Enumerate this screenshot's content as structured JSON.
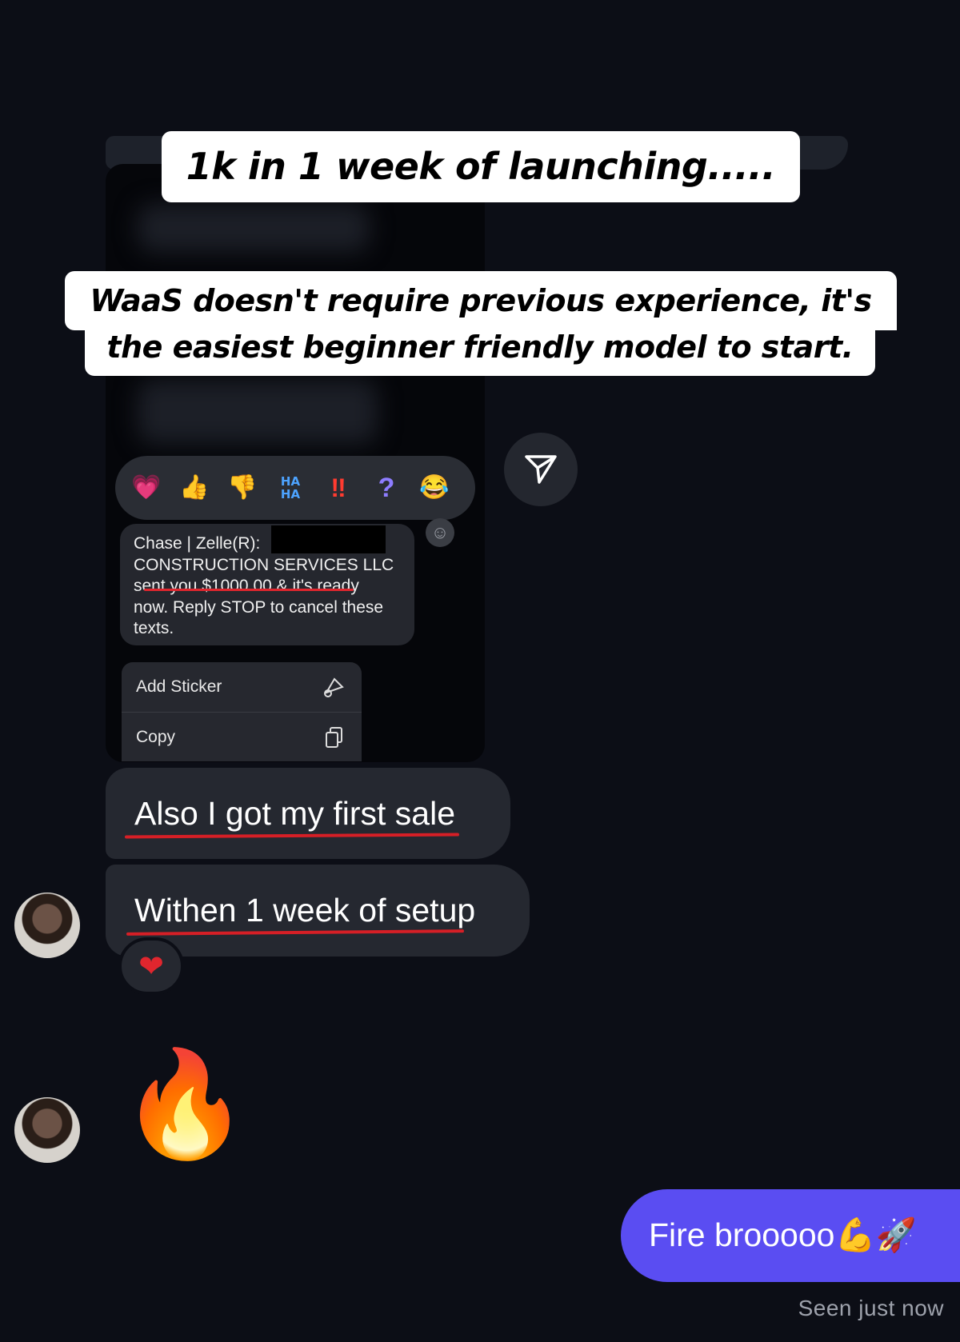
{
  "captions": {
    "headline": "1k in 1 week of launching.....",
    "line1": "WaaS doesn't require previous experience, it's",
    "line2": "the easiest beginner friendly model to start."
  },
  "reactions": [
    "heart",
    "thumbs-up",
    "thumbs-down",
    "haha",
    "exclamation",
    "question",
    "laugh"
  ],
  "reaction_glyphs": {
    "heart": "💗",
    "thumbs_up": "👍",
    "thumbs_down": "👎",
    "haha_top": "HA",
    "haha_bottom": "HA",
    "exclamation": "‼",
    "question": "?",
    "laugh": "😂"
  },
  "zelle_message": {
    "line1": "Chase | Zelle(R):",
    "line2": "CONSTRUCTION SERVICES LLC",
    "line3": "sent you $1000.00 & it's ready",
    "line4": "now. Reply STOP to cancel these",
    "line5": "texts."
  },
  "context_menu": {
    "add_sticker": "Add Sticker",
    "copy": "Copy"
  },
  "chat": {
    "msg1": "Also I got my first sale",
    "msg2": "Withen 1 week of setup",
    "reaction_on_msg2": "❤",
    "fire_emoji": "🔥",
    "my_reply": "Fire brooooo💪🚀",
    "seen_status": "Seen just now"
  },
  "colors": {
    "background": "#0c0e16",
    "incoming_bubble": "#252830",
    "outgoing_bubble": "#5a4df2",
    "underline": "#d61f26"
  }
}
